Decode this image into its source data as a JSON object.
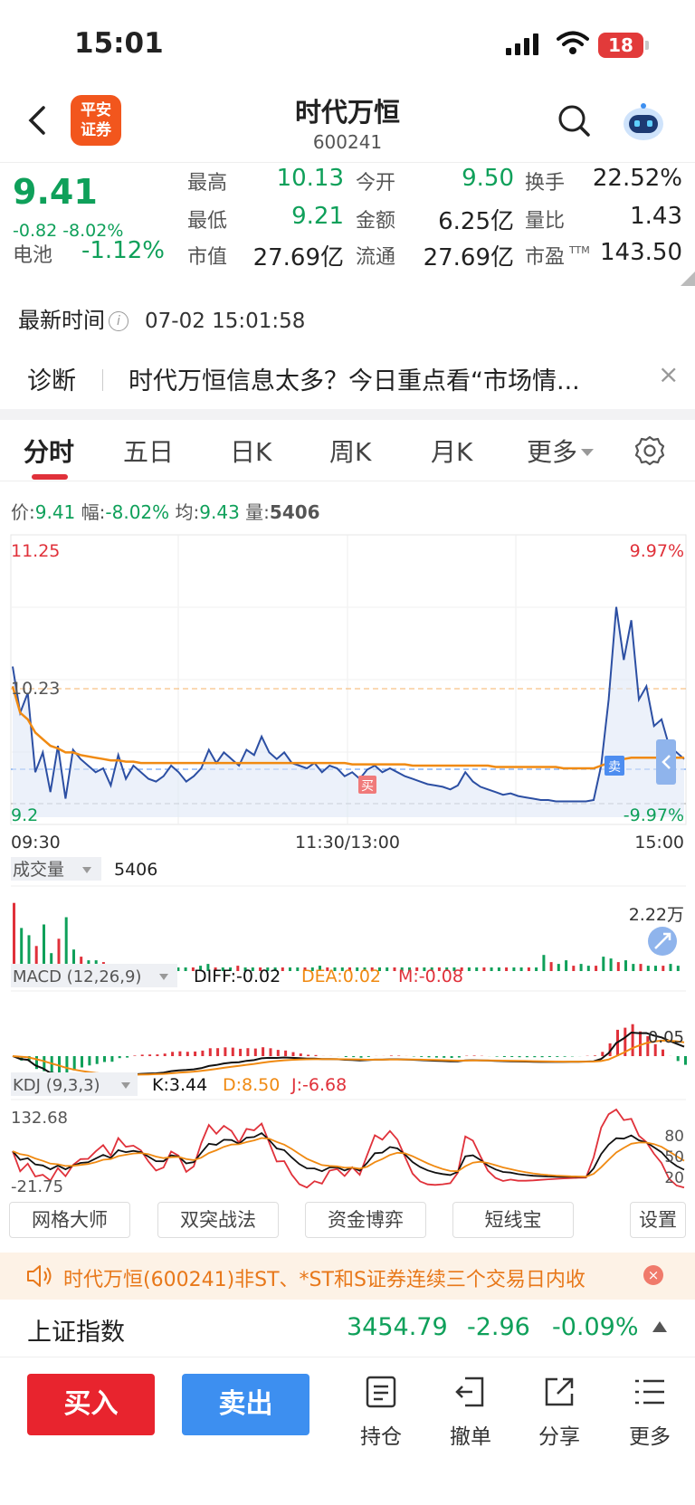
{
  "status": {
    "time": "15:01",
    "battery": "18"
  },
  "header": {
    "title": "时代万恒",
    "code": "600241",
    "logo_line1": "平安",
    "logo_line2": "证券"
  },
  "quote": {
    "price": "9.41",
    "change": "-0.82 -8.02%",
    "sector_label": "电池",
    "sector_value": "-1.12%",
    "high_label": "最高",
    "high": "10.13",
    "low_label": "最低",
    "low": "9.21",
    "mktcap_label": "市值",
    "mktcap": "27.69亿",
    "open_label": "今开",
    "open": "9.50",
    "amount_label": "金额",
    "amount": "6.25亿",
    "float_label": "流通",
    "float": "27.69亿",
    "turnover_label": "换手",
    "turnover": "22.52%",
    "volratio_label": "量比",
    "volratio": "1.43",
    "pe_label": "市盈",
    "pe_sup": "TTM",
    "pe": "143.50"
  },
  "update": {
    "label": "最新时间",
    "info_icon": "i",
    "time": "07-02 15:01:58"
  },
  "diagnosis": {
    "label": "诊断",
    "text": "时代万恒信息太多？今日重点看“市场情...",
    "close": "×"
  },
  "tabs": [
    "分时",
    "五日",
    "日K",
    "周K",
    "月K",
    "更多"
  ],
  "info_row": {
    "price_label": "价:",
    "price": "9.41",
    "range_label": "幅:",
    "range": "-8.02%",
    "avg_label": "均:",
    "avg": "9.43",
    "vol_label": "量:",
    "vol": "5406"
  },
  "chart_data": {
    "type": "line",
    "title": "",
    "price_axis": {
      "top_label": "11.25",
      "mid_label": "10.23",
      "bottom_label": "9.2",
      "top_pct": "9.97%",
      "bottom_pct": "-9.97%",
      "ylim": [
        9.21,
        11.25
      ]
    },
    "x_labels": [
      "09:30",
      "11:30/13:00",
      "15:00"
    ],
    "markers": {
      "buy": "买",
      "sell": "卖"
    },
    "series": [
      {
        "name": "价",
        "color": "#2c4fa3",
        "values": [
          10.35,
          10.0,
          10.15,
          9.55,
          9.7,
          9.4,
          9.75,
          9.35,
          9.72,
          9.65,
          9.6,
          9.55,
          9.58,
          9.45,
          9.68,
          9.5,
          9.6,
          9.55,
          9.5,
          9.48,
          9.52,
          9.6,
          9.55,
          9.48,
          9.52,
          9.58,
          9.72,
          9.62,
          9.7,
          9.65,
          9.6,
          9.72,
          9.68,
          9.82,
          9.7,
          9.65,
          9.7,
          9.62,
          9.6,
          9.58,
          9.62,
          9.55,
          9.6,
          9.58,
          9.52,
          9.55,
          9.5,
          9.57,
          9.6,
          9.55,
          9.58,
          9.55,
          9.52,
          9.5,
          9.48,
          9.46,
          9.45,
          9.44,
          9.42,
          9.45,
          9.55,
          9.48,
          9.44,
          9.42,
          9.4,
          9.38,
          9.39,
          9.37,
          9.36,
          9.35,
          9.34,
          9.34,
          9.33,
          9.33,
          9.33,
          9.33,
          9.33,
          9.34,
          9.6,
          10.1,
          10.8,
          10.4,
          10.7,
          10.1,
          10.2,
          9.9,
          9.95,
          9.75,
          9.7,
          9.65
        ]
      },
      {
        "name": "均",
        "color": "#f08a12",
        "values": [
          10.2,
          10.0,
          9.95,
          9.85,
          9.8,
          9.75,
          9.73,
          9.7,
          9.7,
          9.68,
          9.67,
          9.66,
          9.65,
          9.64,
          9.64,
          9.63,
          9.63,
          9.62,
          9.62,
          9.62,
          9.62,
          9.62,
          9.62,
          9.62,
          9.62,
          9.62,
          9.62,
          9.62,
          9.62,
          9.62,
          9.62,
          9.62,
          9.62,
          9.62,
          9.62,
          9.62,
          9.62,
          9.62,
          9.62,
          9.62,
          9.62,
          9.62,
          9.62,
          9.62,
          9.62,
          9.61,
          9.61,
          9.61,
          9.61,
          9.61,
          9.61,
          9.61,
          9.61,
          9.6,
          9.6,
          9.6,
          9.6,
          9.6,
          9.6,
          9.6,
          9.6,
          9.6,
          9.6,
          9.6,
          9.59,
          9.59,
          9.59,
          9.59,
          9.59,
          9.59,
          9.59,
          9.59,
          9.59,
          9.58,
          9.58,
          9.58,
          9.58,
          9.58,
          9.6,
          9.62,
          9.64,
          9.65,
          9.66,
          9.66,
          9.66,
          9.66,
          9.66,
          9.66,
          9.66,
          9.66
        ]
      }
    ],
    "volume": {
      "label": "成交量",
      "value": "5406",
      "max_label": "2.22万",
      "values": [
        1.9,
        1.2,
        1.0,
        0.7,
        1.3,
        0.5,
        0.9,
        1.5,
        0.6,
        0.4,
        0.3,
        0.3,
        0.25,
        0.2,
        0.2,
        0.2,
        0.15,
        0.15,
        0.15,
        0.15,
        0.1,
        0.15,
        0.1,
        0.1,
        0.1,
        0.15,
        0.2,
        0.1,
        0.1,
        0.1,
        0.15,
        0.1,
        0.1,
        0.1,
        0.1,
        0.1,
        0.1,
        0.1,
        0.1,
        0.1,
        0.1,
        0.15,
        0.1,
        0.1,
        0.1,
        0.1,
        0.1,
        0.1,
        0.1,
        0.1,
        0.1,
        0.1,
        0.1,
        0.1,
        0.1,
        0.1,
        0.1,
        0.1,
        0.1,
        0.1,
        0.1,
        0.1,
        0.1,
        0.1,
        0.1,
        0.1,
        0.1,
        0.1,
        0.1,
        0.1,
        0.1,
        0.45,
        0.25,
        0.2,
        0.3,
        0.15,
        0.2,
        0.15,
        0.15,
        0.4,
        0.35,
        0.25,
        0.3,
        0.2,
        0.2,
        0.15,
        0.15,
        0.15,
        0.2,
        0.15
      ]
    },
    "macd": {
      "label": "MACD (12,26,9)",
      "diff": "DIFF:-0.02",
      "dea": "DEA:0.02",
      "m": "M:-0.08",
      "right_label": "0.05"
    },
    "kdj": {
      "label": "KDJ (9,3,3)",
      "k": "K:3.44",
      "d": "D:8.50",
      "j": "J:-6.68",
      "top_label": "132.68",
      "bottom_label": "-21.75",
      "levels": [
        "80",
        "50",
        "20"
      ]
    }
  },
  "tools": [
    "网格大师",
    "双突战法",
    "资金博弈",
    "短线宝",
    "设置"
  ],
  "notice": {
    "text": "时代万恒(600241)非ST、*ST和S证券连续三个交易日内收",
    "close": "×"
  },
  "index": {
    "name": "上证指数",
    "value": "3454.79",
    "change": "-2.96",
    "pct": "-0.09%"
  },
  "bottom": {
    "buy": "买入",
    "sell": "卖出",
    "hold": "持仓",
    "cancel": "撤单",
    "share": "分享",
    "more": "更多"
  }
}
